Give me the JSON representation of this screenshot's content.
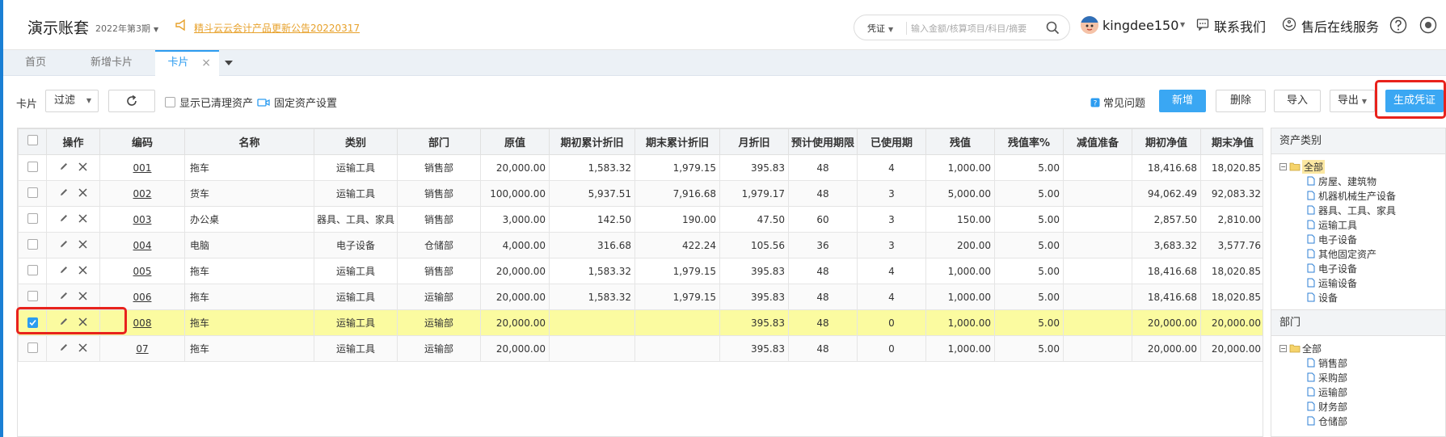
{
  "header": {
    "app_title": "演示账套",
    "period": "2022年第3期",
    "announcement": "精斗云云会计产品更新公告20220317",
    "search_type": "凭证",
    "search_placeholder": "输入金额/核算项目/科目/摘要",
    "username": "kingdee150",
    "contact_label": "联系我们",
    "service_label": "售后在线服务"
  },
  "tabs": [
    {
      "label": "首页"
    },
    {
      "label": "新增卡片"
    },
    {
      "label": "卡片",
      "active": true
    }
  ],
  "toolbar": {
    "card_label": "卡片",
    "filter_label": "过滤",
    "show_cleared_label": "显示已清理资产",
    "asset_settings_label": "固定资产设置",
    "faq_label": "常见问题",
    "add_label": "新增",
    "delete_label": "删除",
    "import_label": "导入",
    "export_label": "导出",
    "generate_voucher_label": "生成凭证"
  },
  "table": {
    "columns": [
      "操作",
      "编码",
      "名称",
      "类别",
      "部门",
      "原值",
      "期初累计折旧",
      "期末累计折旧",
      "月折旧",
      "预计使用期限",
      "已使用期",
      "残值",
      "残值率%",
      "减值准备",
      "期初净值",
      "期末净值"
    ],
    "rows": [
      {
        "checked": false,
        "code": "001",
        "name": "拖车",
        "category": "运输工具",
        "dept": "销售部",
        "original": "20,000.00",
        "open_dep": "1,583.32",
        "close_dep": "1,979.15",
        "monthly": "395.83",
        "life": "48",
        "used": "4",
        "residual": "1,000.00",
        "rate": "5.00",
        "impairment": "",
        "open_net": "18,416.68",
        "close_net": "18,020.85"
      },
      {
        "checked": false,
        "code": "002",
        "name": "货车",
        "category": "运输工具",
        "dept": "销售部",
        "original": "100,000.00",
        "open_dep": "5,937.51",
        "close_dep": "7,916.68",
        "monthly": "1,979.17",
        "life": "48",
        "used": "3",
        "residual": "5,000.00",
        "rate": "5.00",
        "impairment": "",
        "open_net": "94,062.49",
        "close_net": "92,083.32"
      },
      {
        "checked": false,
        "code": "003",
        "name": "办公桌",
        "category": "器具、工具、家具",
        "dept": "销售部",
        "original": "3,000.00",
        "open_dep": "142.50",
        "close_dep": "190.00",
        "monthly": "47.50",
        "life": "60",
        "used": "3",
        "residual": "150.00",
        "rate": "5.00",
        "impairment": "",
        "open_net": "2,857.50",
        "close_net": "2,810.00"
      },
      {
        "checked": false,
        "code": "004",
        "name": "电脑",
        "category": "电子设备",
        "dept": "仓储部",
        "original": "4,000.00",
        "open_dep": "316.68",
        "close_dep": "422.24",
        "monthly": "105.56",
        "life": "36",
        "used": "3",
        "residual": "200.00",
        "rate": "5.00",
        "impairment": "",
        "open_net": "3,683.32",
        "close_net": "3,577.76"
      },
      {
        "checked": false,
        "code": "005",
        "name": "拖车",
        "category": "运输工具",
        "dept": "销售部",
        "original": "20,000.00",
        "open_dep": "1,583.32",
        "close_dep": "1,979.15",
        "monthly": "395.83",
        "life": "48",
        "used": "4",
        "residual": "1,000.00",
        "rate": "5.00",
        "impairment": "",
        "open_net": "18,416.68",
        "close_net": "18,020.85"
      },
      {
        "checked": false,
        "code": "006",
        "name": "拖车",
        "category": "运输工具",
        "dept": "运输部",
        "original": "20,000.00",
        "open_dep": "1,583.32",
        "close_dep": "1,979.15",
        "monthly": "395.83",
        "life": "48",
        "used": "4",
        "residual": "1,000.00",
        "rate": "5.00",
        "impairment": "",
        "open_net": "18,416.68",
        "close_net": "18,020.85"
      },
      {
        "checked": true,
        "code": "008",
        "name": "拖车",
        "category": "运输工具",
        "dept": "运输部",
        "original": "20,000.00",
        "open_dep": "",
        "close_dep": "",
        "monthly": "395.83",
        "life": "48",
        "used": "0",
        "residual": "1,000.00",
        "rate": "5.00",
        "impairment": "",
        "open_net": "20,000.00",
        "close_net": "20,000.00"
      },
      {
        "checked": false,
        "code": "07",
        "name": "拖车",
        "category": "运输工具",
        "dept": "运输部",
        "original": "20,000.00",
        "open_dep": "",
        "close_dep": "",
        "monthly": "395.83",
        "life": "48",
        "used": "0",
        "residual": "1,000.00",
        "rate": "5.00",
        "impairment": "",
        "open_net": "20,000.00",
        "close_net": "20,000.00"
      }
    ]
  },
  "asset_tree": {
    "title": "资产类别",
    "root": "全部",
    "items": [
      "房屋、建筑物",
      "机器机械生产设备",
      "器具、工具、家具",
      "运输工具",
      "电子设备",
      "其他固定资产",
      "电子设备",
      "运输设备",
      "设备"
    ]
  },
  "dept_tree": {
    "title": "部门",
    "root": "全部",
    "items": [
      "销售部",
      "采购部",
      "运输部",
      "财务部",
      "仓储部"
    ]
  },
  "colors": {
    "accent": "#2c9cf0",
    "primary_button": "#3aa7f3",
    "highlight_row": "#fbfba0",
    "annotation_red": "#e8221c",
    "announcement": "#e7a12b"
  }
}
